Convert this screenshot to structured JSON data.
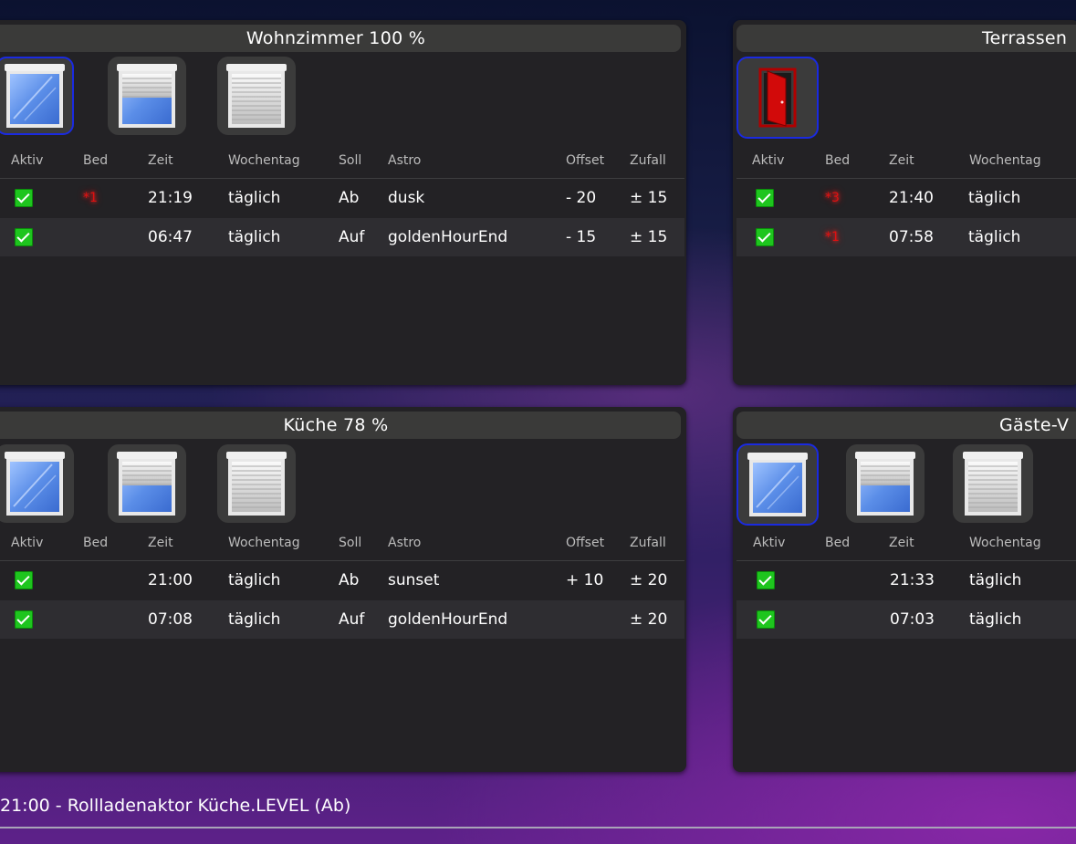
{
  "headers": {
    "aktiv": "Aktiv",
    "bed": "Bed",
    "zeit": "Zeit",
    "wochentag": "Wochentag",
    "soll": "Soll",
    "astro": "Astro",
    "offset": "Offset",
    "zufall": "Zufall"
  },
  "panels": [
    {
      "title": "Wohnzimmer 100 %",
      "rows": [
        {
          "aktiv": true,
          "bed": "*1",
          "zeit": "21:19",
          "wochentag": "täglich",
          "soll": "Ab",
          "astro": "dusk",
          "offset": "- 20",
          "zufall": "± 15"
        },
        {
          "aktiv": true,
          "bed": "",
          "zeit": "06:47",
          "wochentag": "täglich",
          "soll": "Auf",
          "astro": "goldenHourEnd",
          "offset": "- 15",
          "zufall": "± 15"
        }
      ]
    },
    {
      "title": "Terrassen",
      "rows": [
        {
          "aktiv": true,
          "bed": "*3",
          "zeit": "21:40",
          "wochentag": "täglich"
        },
        {
          "aktiv": true,
          "bed": "*1",
          "zeit": "07:58",
          "wochentag": "täglich"
        }
      ]
    },
    {
      "title": "Küche 78 %",
      "rows": [
        {
          "aktiv": true,
          "bed": "",
          "zeit": "21:00",
          "wochentag": "täglich",
          "soll": "Ab",
          "astro": "sunset",
          "offset": "+ 10",
          "zufall": "± 20"
        },
        {
          "aktiv": true,
          "bed": "",
          "zeit": "07:08",
          "wochentag": "täglich",
          "soll": "Auf",
          "astro": "goldenHourEnd",
          "offset": "",
          "zufall": "± 20"
        }
      ]
    },
    {
      "title": "Gäste-V",
      "rows": [
        {
          "aktiv": true,
          "bed": "",
          "zeit": "21:33",
          "wochentag": "täglich"
        },
        {
          "aktiv": true,
          "bed": "",
          "zeit": "07:03",
          "wochentag": "täglich"
        }
      ]
    }
  ],
  "status": {
    "text": "21:00 - Rollladenaktor Küche.LEVEL (Ab)"
  },
  "colors": {
    "panel": "#232225",
    "checkbox": "#1ec51e",
    "selected_border": "#1a2ae0",
    "bed_marker": "#e01010"
  }
}
